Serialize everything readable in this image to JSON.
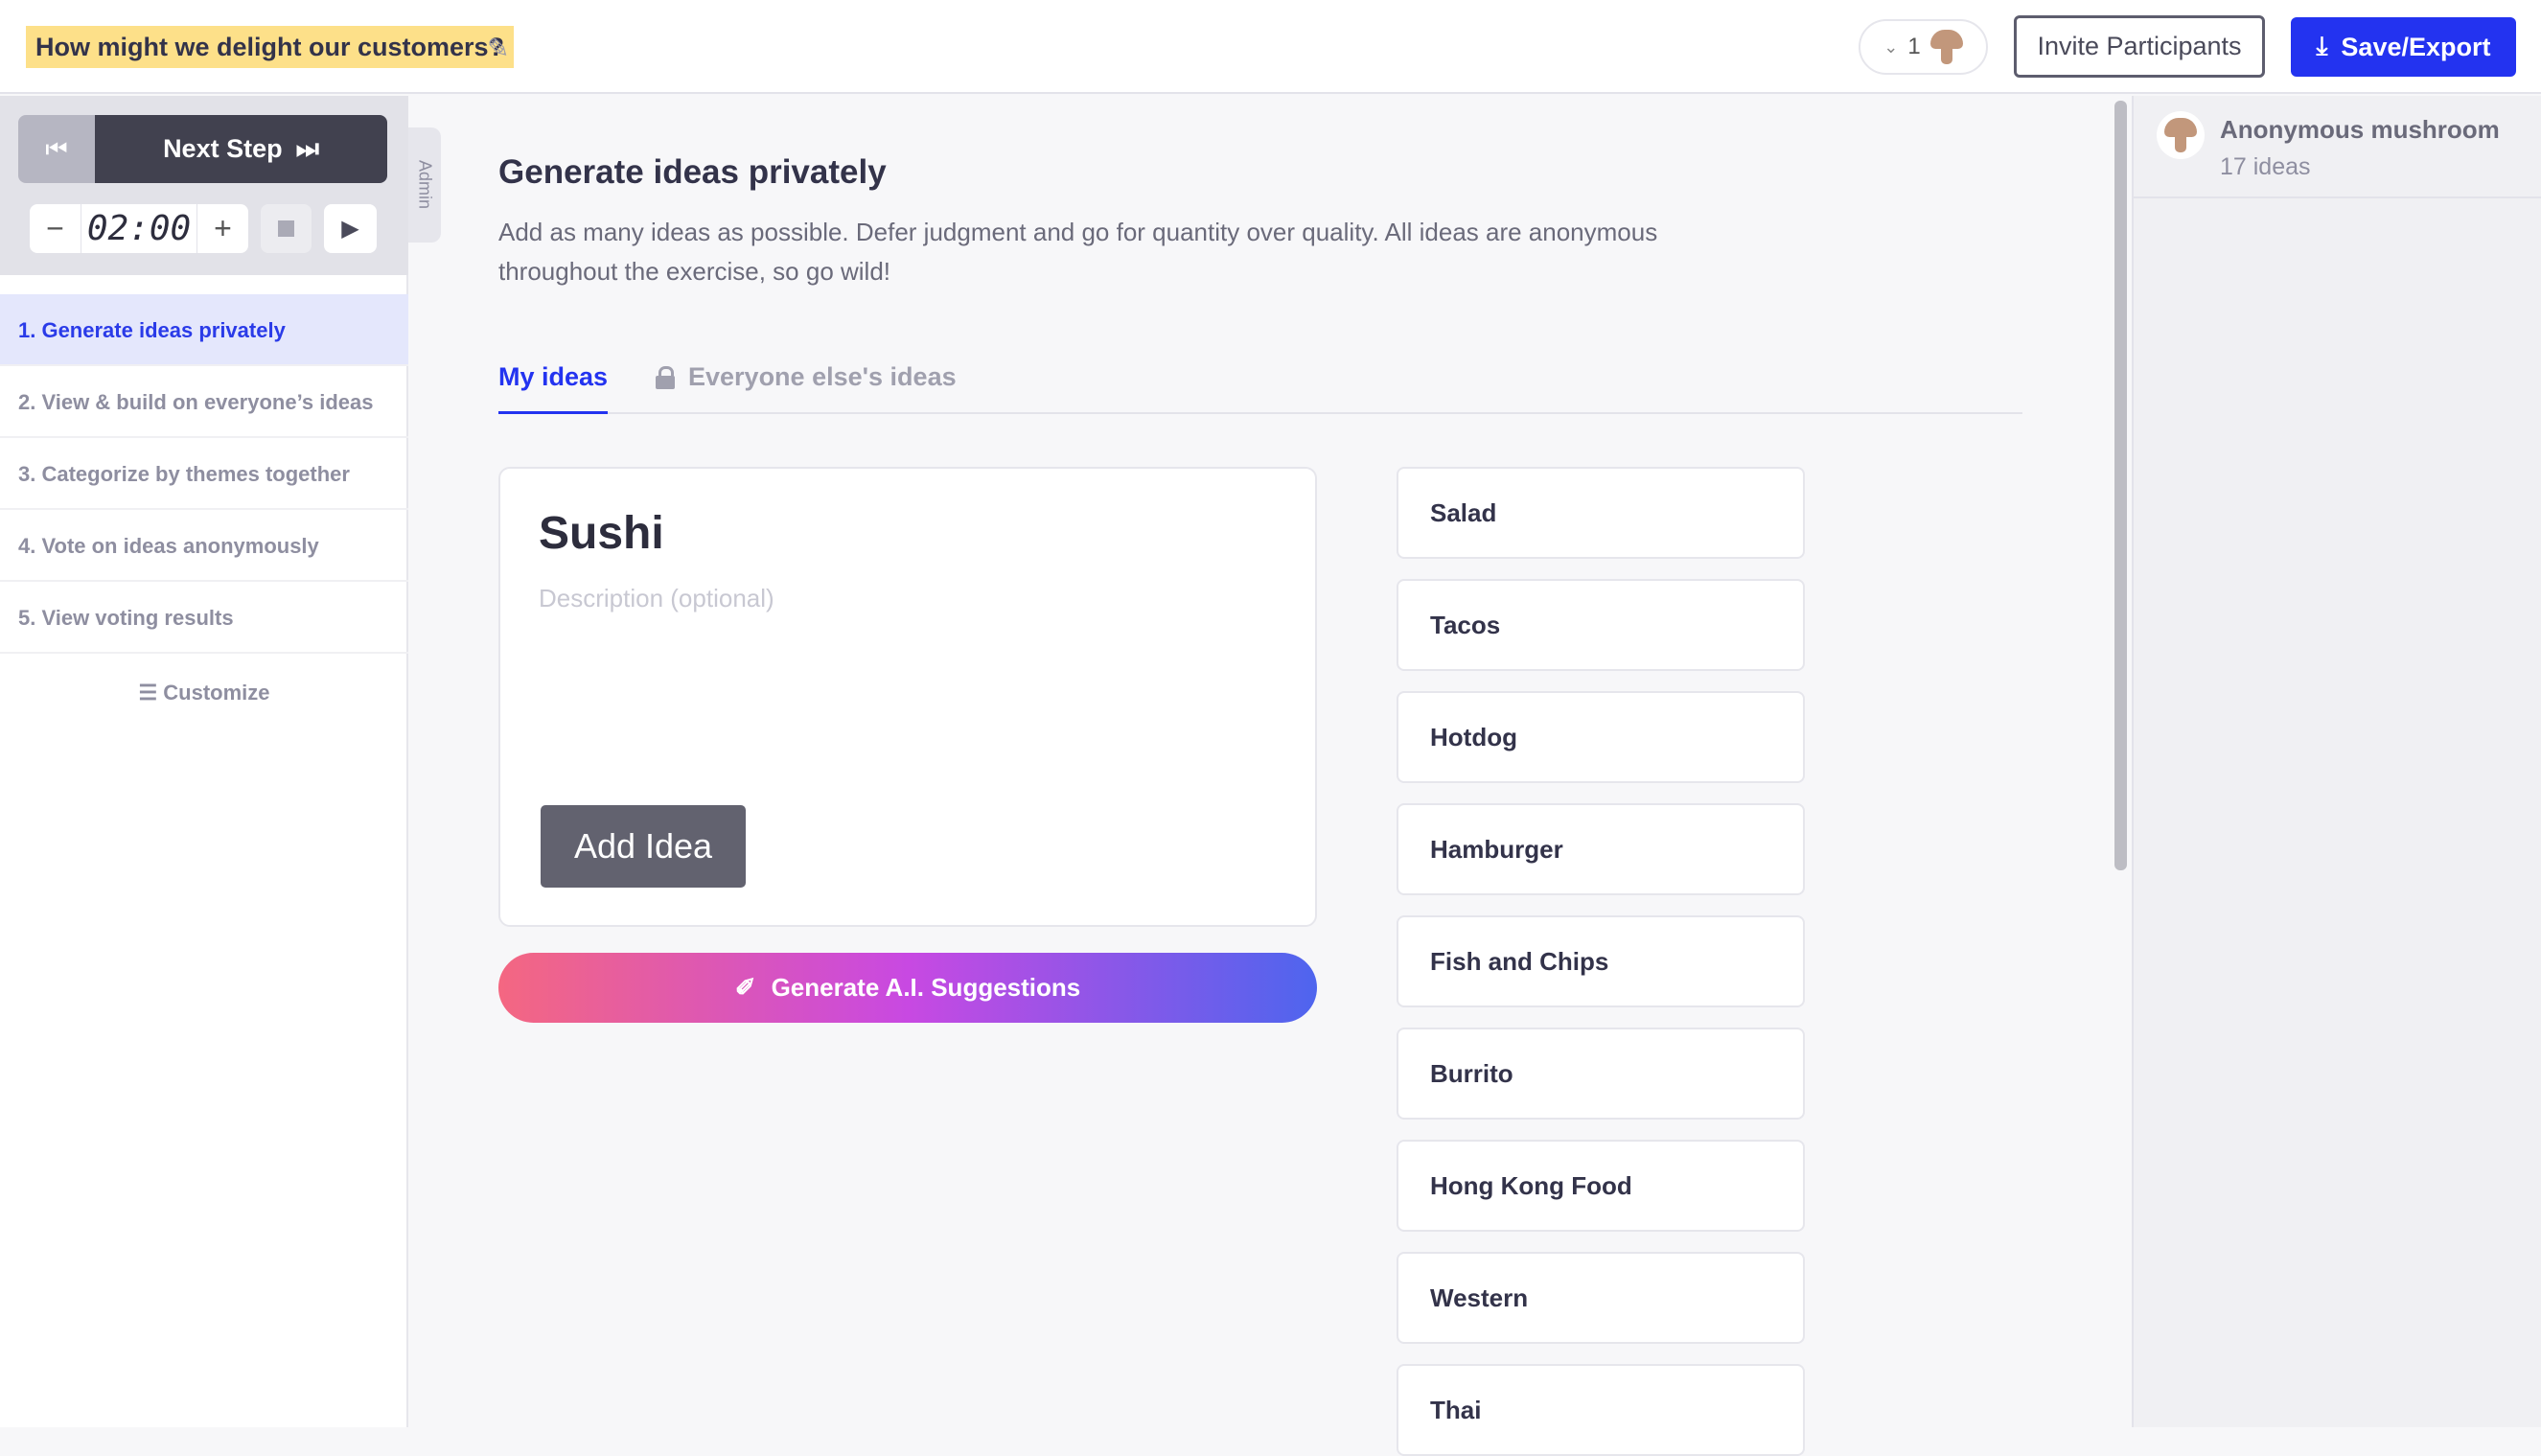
{
  "header": {
    "title": "How might we delight our customers?",
    "participant_count": "1",
    "invite_label": "Invite Participants",
    "save_label": "Save/Export"
  },
  "sidebar": {
    "next_step_label": "Next Step",
    "timer": "02:00",
    "admin_label": "Admin",
    "steps": [
      {
        "label": "1. Generate ideas privately"
      },
      {
        "label": "2. View & build on everyone’s ideas"
      },
      {
        "label": "3. Categorize by themes together"
      },
      {
        "label": "4. Vote on ideas anonymously"
      },
      {
        "label": "5. View voting results"
      }
    ],
    "customize_label": "Customize"
  },
  "main": {
    "heading": "Generate ideas privately",
    "description": "Add as many ideas as possible. Defer judgment and go for quantity over quality. All ideas are anonymous throughout the exercise, so go wild!",
    "tabs": [
      {
        "label": "My ideas"
      },
      {
        "label": "Everyone else's ideas"
      }
    ],
    "idea_title": "Sushi",
    "idea_description_placeholder": "Description (optional)",
    "add_idea_label": "Add Idea",
    "ai_label": "Generate A.I. Suggestions",
    "ideas": [
      "Salad",
      "Tacos",
      "Hotdog",
      "Hamburger",
      "Fish and Chips",
      "Burrito",
      "Hong Kong Food",
      "Western",
      "Thai"
    ]
  },
  "participants": {
    "name": "Anonymous mushroom",
    "count": "17 ideas"
  },
  "colors": {
    "accent": "#2333f0",
    "highlight": "#fde089",
    "avatar": "#c2977b"
  }
}
